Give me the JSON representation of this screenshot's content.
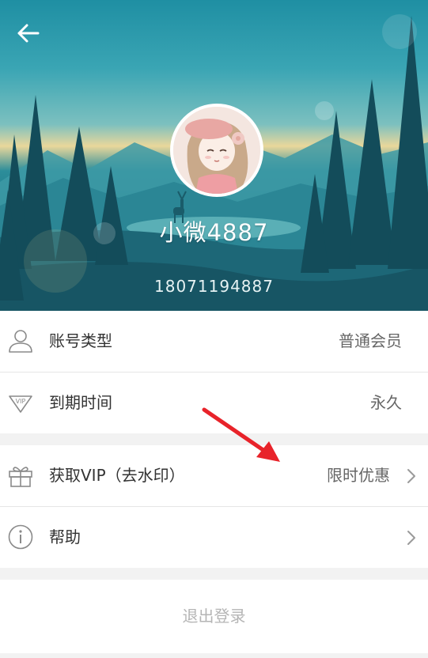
{
  "profile": {
    "username": "小微4887",
    "phone": "18071194887"
  },
  "account_rows": [
    {
      "label": "账号类型",
      "value": "普通会员"
    },
    {
      "label": "到期时间",
      "value": "永久"
    }
  ],
  "action_rows": [
    {
      "label": "获取VIP（去水印）",
      "value": "限时优惠"
    },
    {
      "label": "帮助",
      "value": ""
    }
  ],
  "logout_label": "退出登录",
  "colors": {
    "header_teal": "#2a8d9a",
    "annotation_arrow": "#e8232a",
    "logout_text": "#b5b5b5"
  }
}
